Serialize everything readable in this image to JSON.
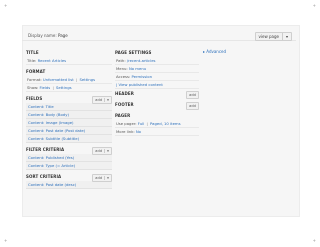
{
  "corners": {
    "tl": "+",
    "tr": "+",
    "bl": "+",
    "br": "+"
  },
  "display": {
    "label": "Display name:",
    "value": "Page",
    "view_button": "view page",
    "caret": "▾"
  },
  "col1": {
    "title": {
      "heading": "TITLE",
      "title_label": "Title:",
      "title_value": "Recent Articles"
    },
    "format": {
      "heading": "FORMAT",
      "format_label": "Format:",
      "format_value": "Unformatted list",
      "format_sep": "|",
      "format_settings": "Settings",
      "show_label": "Show:",
      "show_value": "Fields",
      "show_sep": "|",
      "show_settings": "Settings"
    },
    "fields": {
      "heading": "FIELDS",
      "add": "add",
      "caret": "▾",
      "items": [
        "Content: Title",
        "Content: Body (Body)",
        "Content: Image (Image)",
        "Content: Post date (Post date)",
        "Content: Subtitle (Subtitle)"
      ]
    },
    "filter": {
      "heading": "FILTER CRITERIA",
      "add": "add",
      "caret": "▾",
      "items": [
        "Content: Published (Yes)",
        "Content: Type (= Article)"
      ]
    },
    "sort": {
      "heading": "SORT CRITERIA",
      "add": "add",
      "caret": "▾",
      "items": [
        "Content: Post date (desc)"
      ]
    }
  },
  "col2": {
    "page": {
      "heading": "PAGE SETTINGS",
      "path_label": "Path:",
      "path_value": "/recent-articles",
      "menu_label": "Menu:",
      "menu_value": "No menu",
      "access_label": "Access:",
      "access_value": "Permission",
      "access_extra": "| View published content"
    },
    "header": {
      "heading": "HEADER",
      "add": "add"
    },
    "footer": {
      "heading": "FOOTER",
      "add": "add"
    },
    "pager": {
      "heading": "PAGER",
      "use_label": "Use pager:",
      "use_value": "Full",
      "use_sep": "|",
      "use_extra": "Paged, 10 items",
      "more_label": "More link:",
      "more_value": "No"
    }
  },
  "col3": {
    "advanced": "▸ Advanced"
  }
}
